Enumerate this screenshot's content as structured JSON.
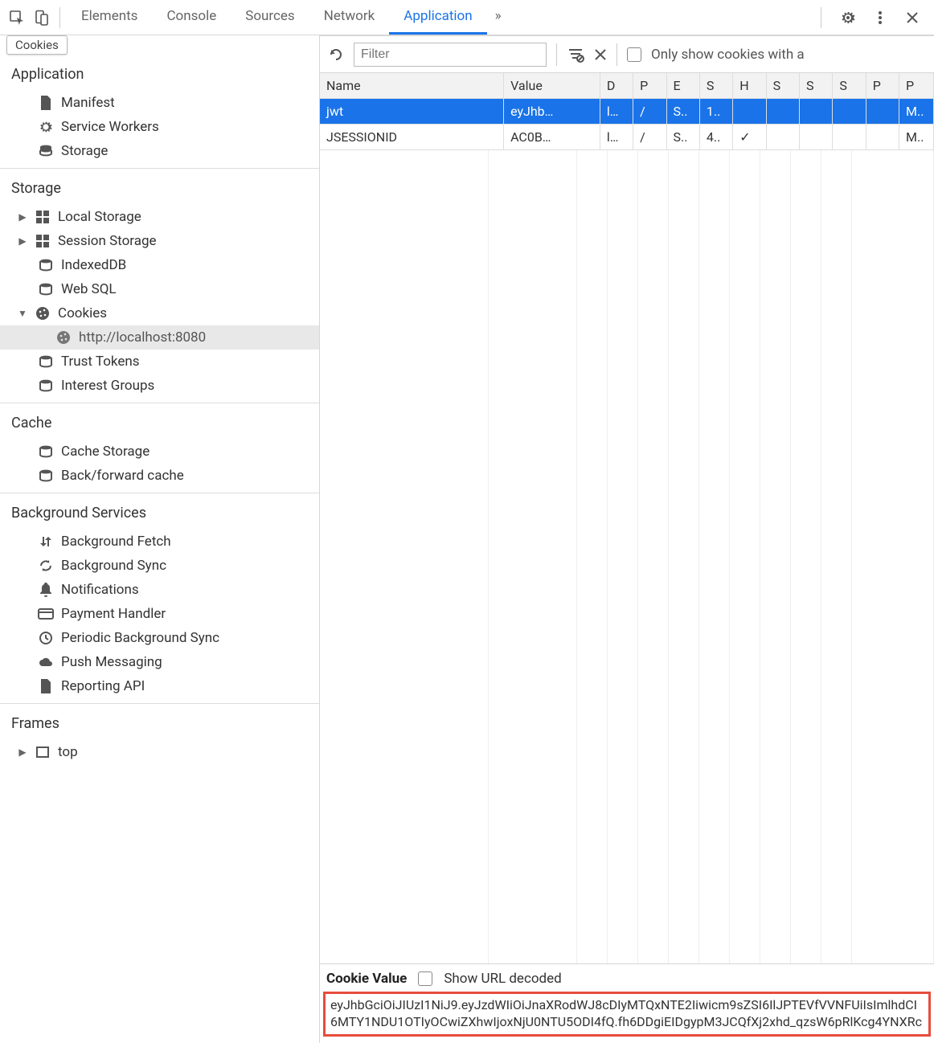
{
  "tooltip": "Cookies",
  "top_tabs": {
    "items": [
      "Elements",
      "Console",
      "Sources",
      "Network",
      "Application"
    ],
    "more_glyph": "»",
    "active_index": 4
  },
  "sidebar": {
    "sections": {
      "application": {
        "title": "Application",
        "items": [
          {
            "label": "Manifest",
            "icon": "file"
          },
          {
            "label": "Service Workers",
            "icon": "gear"
          },
          {
            "label": "Storage",
            "icon": "db"
          }
        ]
      },
      "storage": {
        "title": "Storage",
        "items": [
          {
            "label": "Local Storage",
            "icon": "grid",
            "expandable": true
          },
          {
            "label": "Session Storage",
            "icon": "grid",
            "expandable": true
          },
          {
            "label": "IndexedDB",
            "icon": "db"
          },
          {
            "label": "Web SQL",
            "icon": "db"
          },
          {
            "label": "Cookies",
            "icon": "cookie",
            "expanded": true,
            "children": [
              {
                "label": "http://localhost:8080",
                "icon": "cookie",
                "selected": true
              }
            ]
          },
          {
            "label": "Trust Tokens",
            "icon": "db"
          },
          {
            "label": "Interest Groups",
            "icon": "db"
          }
        ]
      },
      "cache": {
        "title": "Cache",
        "items": [
          {
            "label": "Cache Storage",
            "icon": "db"
          },
          {
            "label": "Back/forward cache",
            "icon": "db"
          }
        ]
      },
      "background": {
        "title": "Background Services",
        "items": [
          {
            "label": "Background Fetch",
            "icon": "swap"
          },
          {
            "label": "Background Sync",
            "icon": "sync"
          },
          {
            "label": "Notifications",
            "icon": "bell"
          },
          {
            "label": "Payment Handler",
            "icon": "card"
          },
          {
            "label": "Periodic Background Sync",
            "icon": "clock"
          },
          {
            "label": "Push Messaging",
            "icon": "cloud"
          },
          {
            "label": "Reporting API",
            "icon": "file"
          }
        ]
      },
      "frames": {
        "title": "Frames",
        "items": [
          {
            "label": "top",
            "icon": "frame",
            "expandable": true
          }
        ]
      }
    }
  },
  "toolbar": {
    "filter_placeholder": "Filter",
    "only_show_label": "Only show cookies with a"
  },
  "table": {
    "headers": [
      "Name",
      "Value",
      "D",
      "P",
      "E",
      "S",
      "H",
      "S",
      "S",
      "S",
      "P",
      "P"
    ],
    "rows": [
      {
        "selected": true,
        "cells": [
          "jwt",
          "eyJhb…",
          "l…",
          "/",
          "S..",
          "1..",
          "",
          "",
          "",
          "",
          "",
          "M.."
        ]
      },
      {
        "selected": false,
        "cells": [
          "JSESSIONID",
          "AC0B…",
          "l…",
          "/",
          "S..",
          "4..",
          "✓",
          "",
          "",
          "",
          "",
          "M.."
        ]
      }
    ]
  },
  "cookie_detail": {
    "label": "Cookie Value",
    "decoded_label": "Show URL decoded",
    "value": "eyJhbGciOiJIUzI1NiJ9.eyJzdWIiOiJnaXRodWJ8cDIyMTQxNTE2Iiwicm9sZSI6IlJPTEVfVVNFUiIsImlhdCI6MTY1NDU1OTIyOCwiZXhwIjoxNjU0NTU5ODI4fQ.fh6DDgiEIDgypM3JCQfXj2xhd_qzsW6pRlKcg4YNXRc"
  }
}
